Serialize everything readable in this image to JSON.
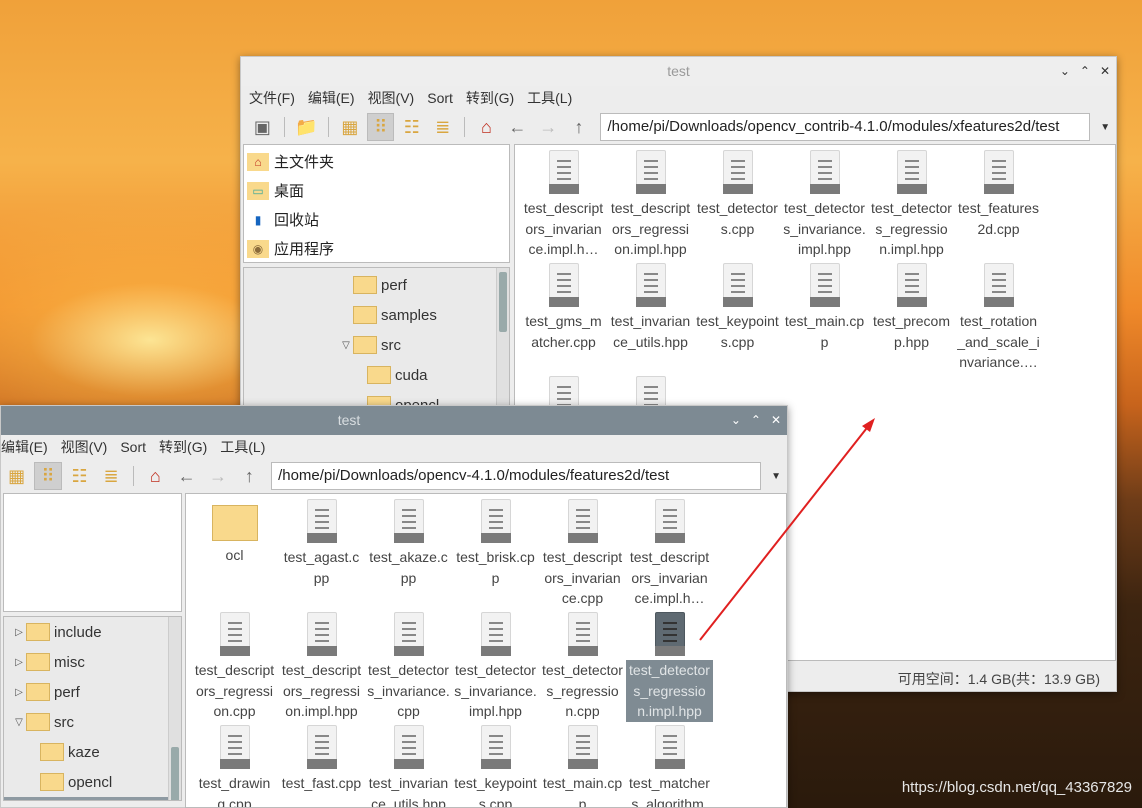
{
  "menu": [
    "文件(F)",
    "编辑(E)",
    "视图(V)",
    "Sort",
    "转到(G)",
    "工具(L)"
  ],
  "places": [
    {
      "label": "主文件夹",
      "icon": "home-folder-icon"
    },
    {
      "label": "桌面",
      "icon": "desktop-icon"
    },
    {
      "label": "回收站",
      "icon": "trash-icon"
    },
    {
      "label": "应用程序",
      "icon": "applications-icon"
    }
  ],
  "back_window": {
    "title": "test",
    "path": "/home/pi/Downloads/opencv_contrib-4.1.0/modules/xfeatures2d/test",
    "tree": [
      {
        "label": "perf",
        "level": 2,
        "arrow": ""
      },
      {
        "label": "samples",
        "level": 2,
        "arrow": ""
      },
      {
        "label": "src",
        "level": 2,
        "arrow": "▽"
      },
      {
        "label": "cuda",
        "level": 3,
        "arrow": ""
      },
      {
        "label": "opencl",
        "level": 3,
        "arrow": ""
      }
    ],
    "files": [
      "test_descriptors_invariance.impl.h…",
      "test_descriptors_regression.impl.hpp",
      "test_detectors.cpp",
      "test_detectors_invariance.impl.hpp",
      "test_detectors_regression.impl.hpp",
      "test_features2d.cpp",
      "test_gms_matcher.cpp",
      "test_invariance_utils.hpp",
      "test_keypoints.cpp",
      "test_main.cpp",
      "test_precomp.hpp",
      "test_rotation_and_scale_invariance.…",
      "",
      ""
    ],
    "status": "可用空间：1.4 GB(共：13.9 GB)"
  },
  "front_window": {
    "title": "test",
    "path": "/home/pi/Downloads/opencv-4.1.0/modules/features2d/test",
    "tree": [
      {
        "label": "include",
        "level": 1,
        "arrow": "▷"
      },
      {
        "label": "misc",
        "level": 1,
        "arrow": "▷"
      },
      {
        "label": "perf",
        "level": 1,
        "arrow": "▷"
      },
      {
        "label": "src",
        "level": 1,
        "arrow": "▽"
      },
      {
        "label": "kaze",
        "level": 2,
        "arrow": ""
      },
      {
        "label": "opencl",
        "level": 2,
        "arrow": ""
      },
      {
        "label": "test",
        "level": 1,
        "arrow": "",
        "selected": true
      }
    ],
    "files": [
      {
        "name": "ocl",
        "type": "folder"
      },
      {
        "name": "test_agast.cpp"
      },
      {
        "name": "test_akaze.cpp"
      },
      {
        "name": "test_brisk.cpp"
      },
      {
        "name": "test_descriptors_invariance.cpp"
      },
      {
        "name": "test_descriptors_invariance.impl.h…"
      },
      {
        "name": "test_descriptors_regression.cpp"
      },
      {
        "name": "test_descriptors_regression.impl.hpp"
      },
      {
        "name": "test_detectors_invariance.cpp"
      },
      {
        "name": "test_detectors_invariance.impl.hpp"
      },
      {
        "name": "test_detectors_regression.cpp"
      },
      {
        "name": "test_detectors_regression.impl.hpp",
        "selected": true
      },
      {
        "name": "test_drawing.cpp"
      },
      {
        "name": "test_fast.cpp"
      },
      {
        "name": "test_invariance_utils.hpp"
      },
      {
        "name": "test_keypoints.cpp"
      },
      {
        "name": "test_main.cpp"
      },
      {
        "name": "test_matchers_algorithm.cpp"
      }
    ]
  },
  "annotation": {
    "color": "#e02020"
  },
  "watermark": "https://blog.csdn.net/qq_43367829"
}
